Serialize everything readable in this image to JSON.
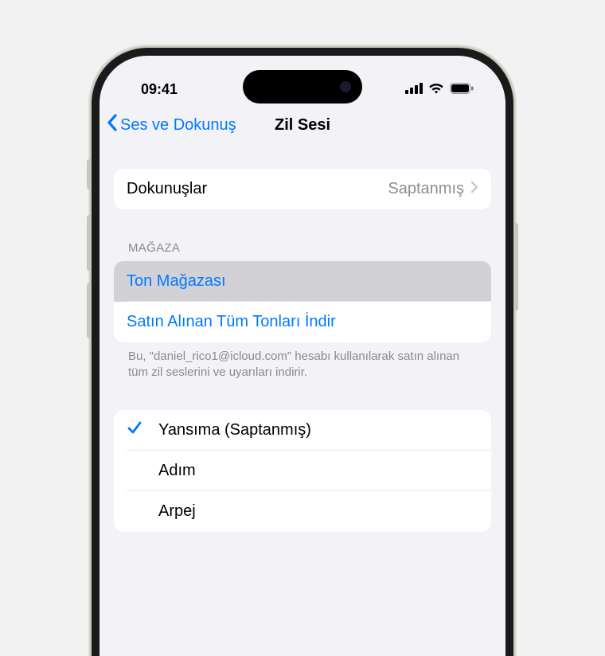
{
  "status": {
    "time": "09:41"
  },
  "nav": {
    "back_label": "Ses ve Dokunuş",
    "title": "Zil Sesi"
  },
  "haptics": {
    "label": "Dokunuşlar",
    "value": "Saptanmış"
  },
  "store": {
    "header": "MAĞAZA",
    "tone_store": "Ton Mağazası",
    "download_all": "Satın Alınan Tüm Tonları İndir",
    "footer": "Bu, \"daniel_rico1@icloud.com\" hesabı kullanılarak satın alınan tüm zil seslerini ve uyarıları indirir."
  },
  "ringtones": {
    "items": [
      {
        "label": "Yansıma (Saptanmış)",
        "selected": true
      },
      {
        "label": "Adım",
        "selected": false
      },
      {
        "label": "Arpej",
        "selected": false
      }
    ]
  }
}
